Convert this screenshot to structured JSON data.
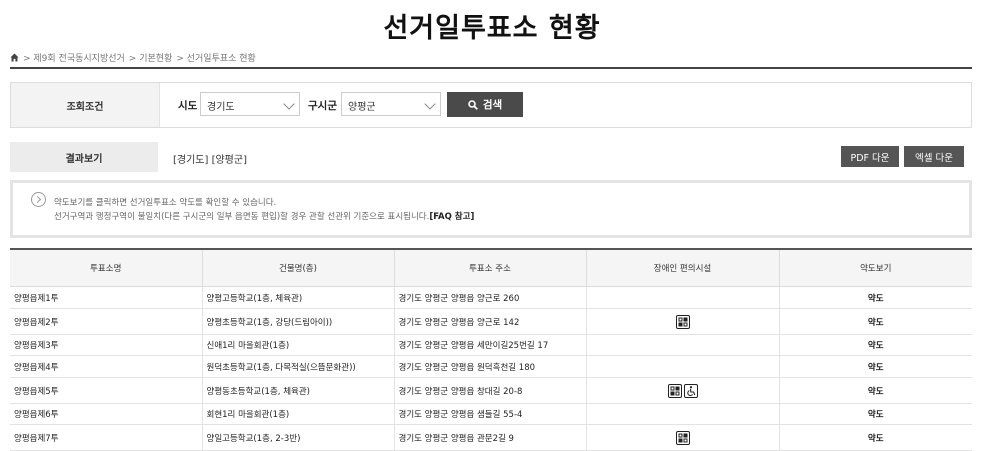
{
  "page": {
    "title": "선거일투표소 현황"
  },
  "breadcrumb": [
    "> 제9회 전국동시지방선거",
    "> 기본현황",
    "> 선거일투표소 현황"
  ],
  "search": {
    "label": "조회조건",
    "sido_label": "시도",
    "sido_value": "경기도",
    "sigungu_label": "구시군",
    "sigungu_value": "양평군",
    "button_label": "검색"
  },
  "result": {
    "label": "결과보기",
    "value": "[경기도] [양평군]",
    "pdf_button": "PDF 다운",
    "excel_button": "엑셀 다운"
  },
  "notice": {
    "line1": "약도보기를 클릭하면 선거일투표소 약도를 확인할 수 있습니다.",
    "line2": "선거구역과 행정구역이 불일치(다른 구시군의 일부 읍면동 편입)할 경우 관할 선관위 기준으로 표시됩니다.",
    "faq": "[FAQ 참고]"
  },
  "table": {
    "headers": [
      "투표소명",
      "건물명(층)",
      "투표소 주소",
      "장애인 편의시설",
      "약도보기"
    ],
    "rows": [
      {
        "name": "양평읍제1투",
        "building": "양평고등학교(1층, 체육관)",
        "address": "경기도 양평군 양평읍 양근로 260",
        "facilities": [],
        "map": "약도"
      },
      {
        "name": "양평읍제2투",
        "building": "양평초등학교(1층, 강당(드림아이))",
        "address": "경기도 양평군 양평읍 양근로 142",
        "facilities": [
          "elevator-icon"
        ],
        "map": "약도"
      },
      {
        "name": "양평읍제3투",
        "building": "신애1리 마을회관(1층)",
        "address": "경기도 양평군 양평읍 세만이길25번길 17",
        "facilities": [],
        "map": "약도"
      },
      {
        "name": "양평읍제4투",
        "building": "원덕초등학교(1층, 다목적실(으뜸문화관))",
        "address": "경기도 양평군 양평읍 원덕흑천길 180",
        "facilities": [],
        "map": "약도"
      },
      {
        "name": "양평읍제5투",
        "building": "양평동초등학교(1층, 체육관)",
        "address": "경기도 양평군 양평읍 창대길 20-8",
        "facilities": [
          "elevator-icon",
          "wheelchair-icon"
        ],
        "map": "약도"
      },
      {
        "name": "양평읍제6투",
        "building": "회현1리 마을회관(1층)",
        "address": "경기도 양평군 양평읍 샘들길 55-4",
        "facilities": [],
        "map": "약도"
      },
      {
        "name": "양평읍제7투",
        "building": "양일고등학교(1층, 2-3반)",
        "address": "경기도 양평군 양평읍 관문2길 9",
        "facilities": [
          "elevator-icon"
        ],
        "map": "약도"
      }
    ]
  },
  "colors": {
    "button_dark": "#4a4a4a",
    "header_bg": "#f5f5f5"
  }
}
